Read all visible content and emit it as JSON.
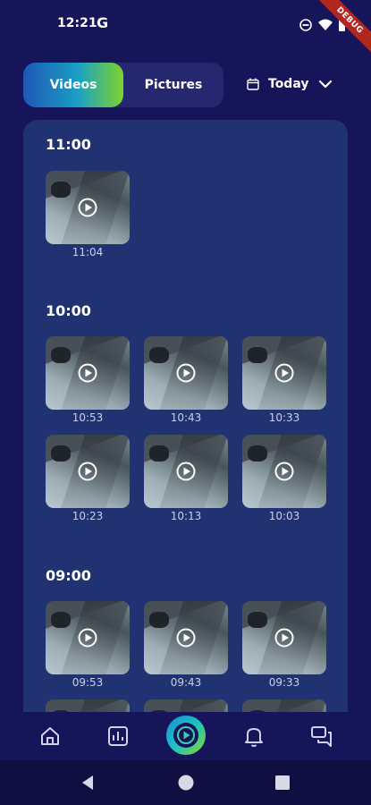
{
  "status_bar": {
    "time": "12:21",
    "app_glyph": "G",
    "icons": [
      "do-not-disturb-icon",
      "wifi-icon",
      "battery-icon"
    ],
    "debug_label": "DEBUG"
  },
  "media_tabs": [
    {
      "label": "Videos",
      "selected": true
    },
    {
      "label": "Pictures",
      "selected": false
    }
  ],
  "date_filter": {
    "label": "Today",
    "icon": "calendar-icon"
  },
  "groups": [
    {
      "title": "11:00",
      "items": [
        {
          "time": "11:04"
        }
      ]
    },
    {
      "title": "10:00",
      "items": [
        {
          "time": "10:53"
        },
        {
          "time": "10:43"
        },
        {
          "time": "10:33"
        },
        {
          "time": "10:23"
        },
        {
          "time": "10:13"
        },
        {
          "time": "10:03"
        }
      ]
    },
    {
      "title": "09:00",
      "items": [
        {
          "time": "09:53"
        },
        {
          "time": "09:43"
        },
        {
          "time": "09:33"
        }
      ]
    }
  ],
  "bottom_nav": [
    "home-icon",
    "chart-icon",
    "play-icon",
    "bell-icon",
    "chat-icon"
  ],
  "colors": {
    "background": "#16155a",
    "panel": "#213273",
    "accent_gradient_start": "#1d57b8",
    "accent_gradient_end": "#7ed32b"
  }
}
